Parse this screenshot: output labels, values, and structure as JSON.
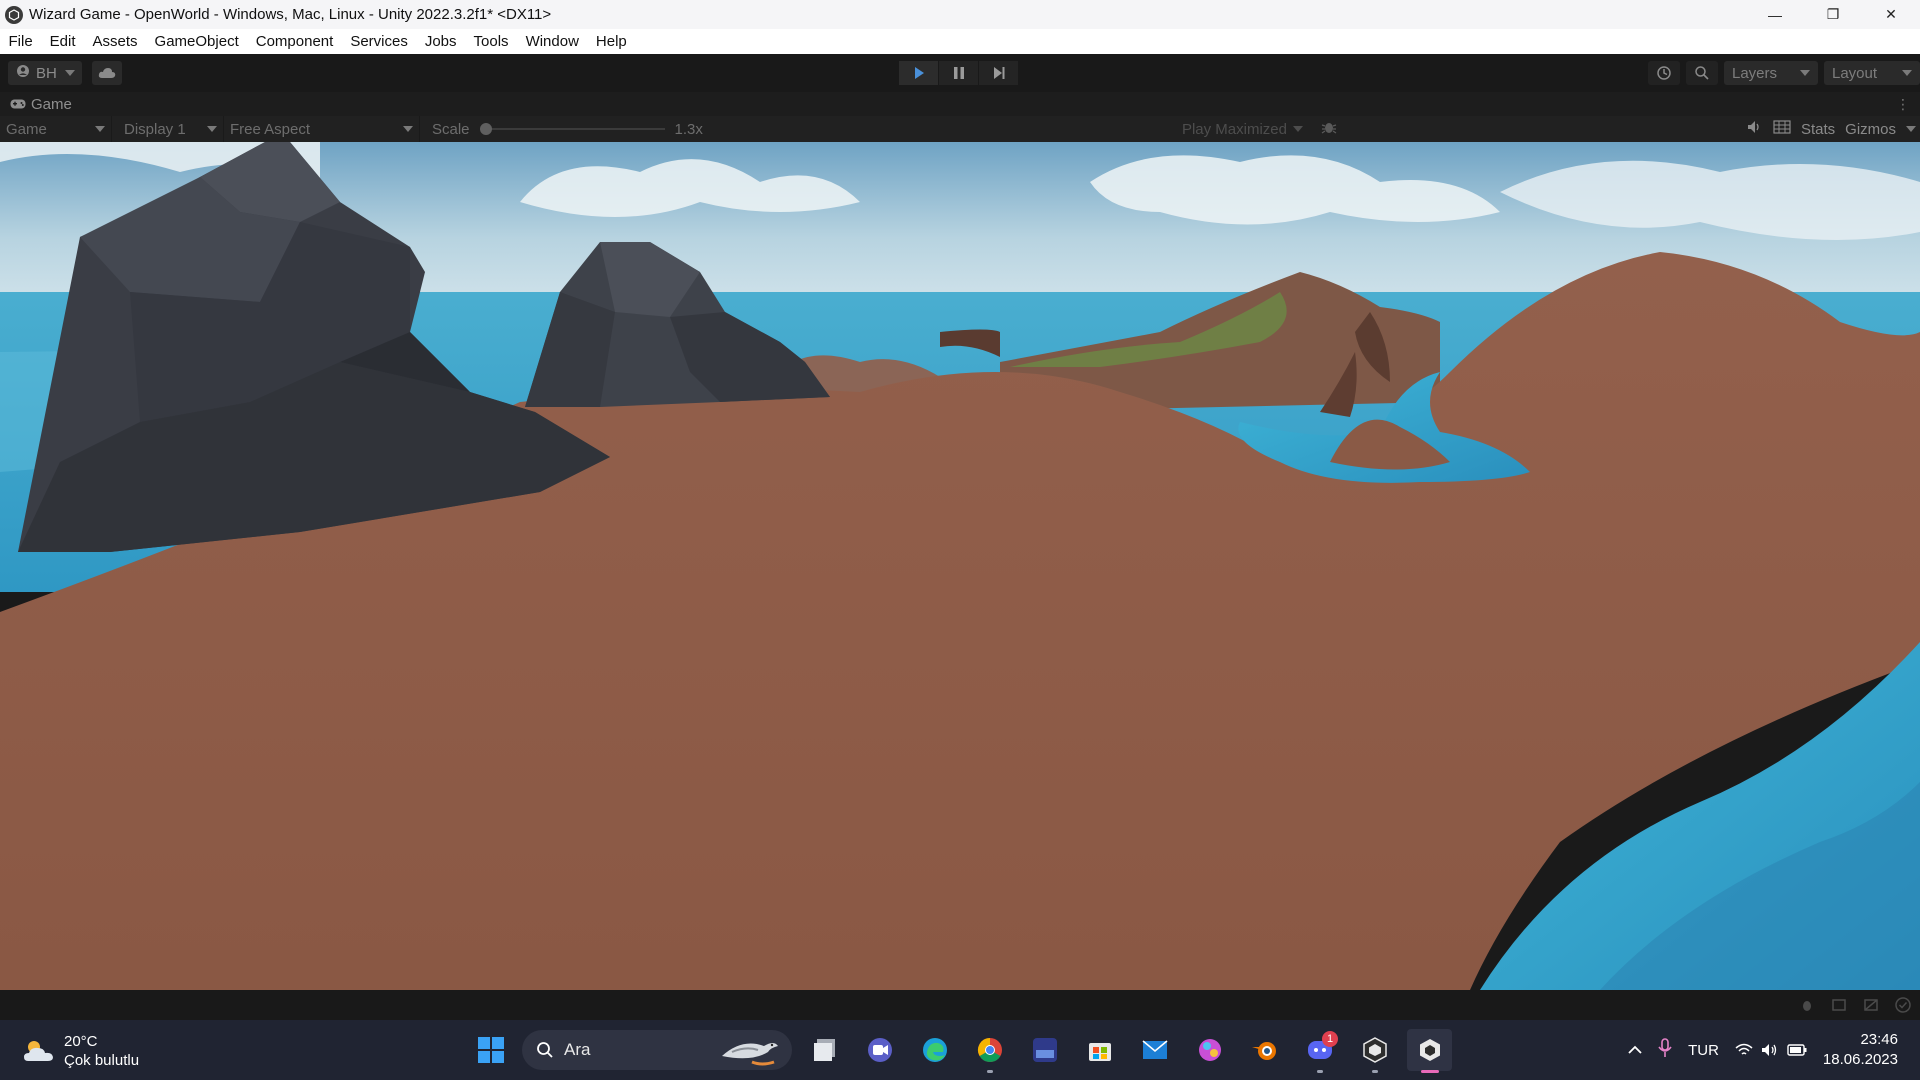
{
  "window": {
    "title": "Wizard Game - OpenWorld - Windows, Mac, Linux - Unity 2022.3.2f1* <DX11>",
    "minimize": "—",
    "restore": "❐",
    "close": "✕"
  },
  "menu": [
    "File",
    "Edit",
    "Assets",
    "GameObject",
    "Component",
    "Services",
    "Jobs",
    "Tools",
    "Window",
    "Help"
  ],
  "toolbar": {
    "account": "BH",
    "layers": "Layers",
    "layout": "Layout"
  },
  "game_tab": {
    "label": "Game"
  },
  "game_controls": {
    "mode": "Game",
    "display": "Display 1",
    "aspect": "Free Aspect",
    "scale_label": "Scale",
    "scale_value": "1.3x",
    "scale_fraction": 0,
    "play_maximized": "Play Maximized",
    "stats": "Stats",
    "gizmos": "Gizmos"
  },
  "taskbar": {
    "temperature": "20°C",
    "weather": "Çok bulutlu",
    "search_placeholder": "Ara",
    "discord_badge": "1",
    "language": "TUR",
    "time": "23:46",
    "date": "18.06.2023",
    "apps": [
      "files-icon",
      "teams-icon",
      "edge-icon",
      "chrome-icon",
      "photoshop-icon",
      "store-icon",
      "mail-icon",
      "paint-icon",
      "blender-icon",
      "discord-icon",
      "unity-hub-icon",
      "unity-icon"
    ]
  },
  "colors": {
    "sand": "#8a5a45",
    "sea": "#3fa7cc",
    "sky": "#9fc4d8",
    "rock": "#3a3d44",
    "accent_taskbar": "#e86ab9"
  }
}
